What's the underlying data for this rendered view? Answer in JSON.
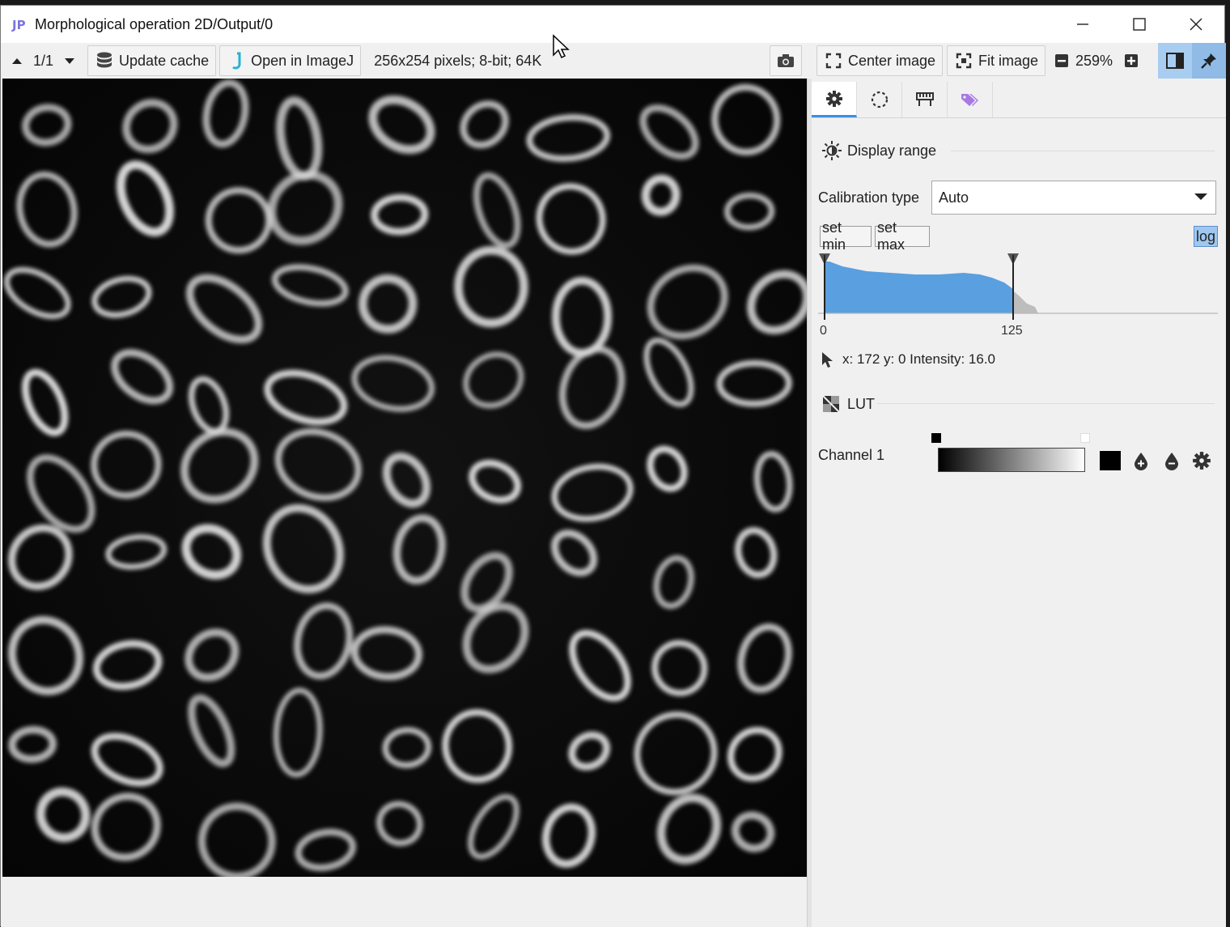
{
  "window": {
    "title": "Morphological operation 2D/Output/0",
    "logo_text": "JIP"
  },
  "toolbar": {
    "page_counter": "1/1",
    "update_cache_label": "Update cache",
    "open_imagej_label": "Open in ImageJ",
    "image_info": "256x254 pixels; 8-bit; 64K",
    "center_image_label": "Center image",
    "fit_image_label": "Fit image",
    "zoom_level": "259%"
  },
  "side_panel": {
    "display_range": {
      "title": "Display range",
      "calibration_label": "Calibration type",
      "calibration_value": "Auto",
      "set_min_label": "set min",
      "set_max_label": "set max",
      "log_label": "log",
      "log_enabled": true,
      "histogram": {
        "min_tick": "0",
        "max_tick": "125",
        "fill_color": "#5a9fe0"
      },
      "cursor_info": "x: 172 y: 0 Intensity: 16.0"
    },
    "lut": {
      "title": "LUT",
      "channel_label": "Channel 1"
    }
  },
  "colors": {
    "accent": "#3d8ee6",
    "logo": "#7b74e0"
  }
}
